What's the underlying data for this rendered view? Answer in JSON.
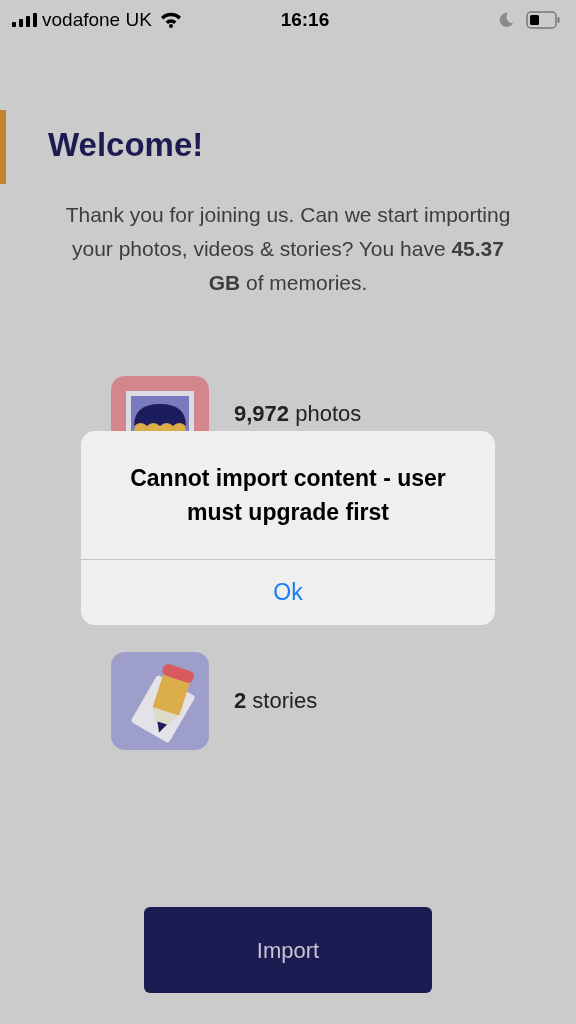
{
  "status_bar": {
    "carrier": "vodafone UK",
    "time": "16:16"
  },
  "heading": "Welcome!",
  "intro": "Thank you for joining us. Can we start importing your photos, videos & stories? You have **45.37 GB** of memories.",
  "items": [
    {
      "kind": "photos",
      "text": "**9,972** photos"
    },
    {
      "kind": "stories",
      "text": "**2** stories"
    }
  ],
  "primary_button": "Import",
  "alert": {
    "title": "Cannot import content - user must upgrade first",
    "button": "Ok"
  }
}
